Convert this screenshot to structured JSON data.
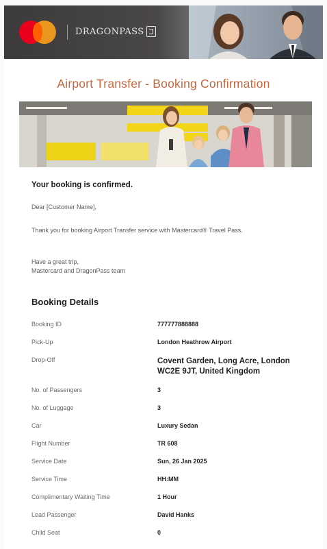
{
  "header": {
    "brand_partner": "DRAGONPASS",
    "brand_logo_icon": "mastercard-logo-icon"
  },
  "title": "Airport Transfer - Booking Confirmation",
  "intro": {
    "confirmed": "Your booking is confirmed.",
    "greeting": "Dear [Customer Name],",
    "thanks": "Thank you for booking Airport Transfer service with Mastercard® Travel Pass.",
    "signoff_line1": "Have a great trip,",
    "signoff_line2": "Mastercard and DragonPass team"
  },
  "booking_details": {
    "heading": "Booking Details",
    "rows": [
      {
        "label": "Booking ID",
        "value": "777777888888"
      },
      {
        "label": "Pick-Up",
        "value": "London Heathrow Airport"
      },
      {
        "label": "Drop-Off",
        "value": "Covent Garden, Long Acre, London WC2E 9JT, United Kingdom"
      },
      {
        "label": "No. of Passengers",
        "value": "3"
      },
      {
        "label": "No. of Luggage",
        "value": "3"
      },
      {
        "label": "Car",
        "value": "Luxury Sedan"
      },
      {
        "label": "Flight Number",
        "value": "TR 608"
      },
      {
        "label": "Service Date",
        "value": "Sun, 26 Jan 2025"
      },
      {
        "label": "Service Time",
        "value": "HH:MM"
      },
      {
        "label": "Complimentary Waiting Time",
        "value": "1 Hour"
      },
      {
        "label": "Lead Passenger",
        "value": "David Hanks"
      },
      {
        "label": "Child Seat",
        "value": "0"
      }
    ]
  },
  "colors": {
    "title_accent": "#c4663e",
    "mastercard_red": "#eb001b",
    "mastercard_orange": "#f79e1b",
    "header_bg": "#3c3a3b"
  }
}
